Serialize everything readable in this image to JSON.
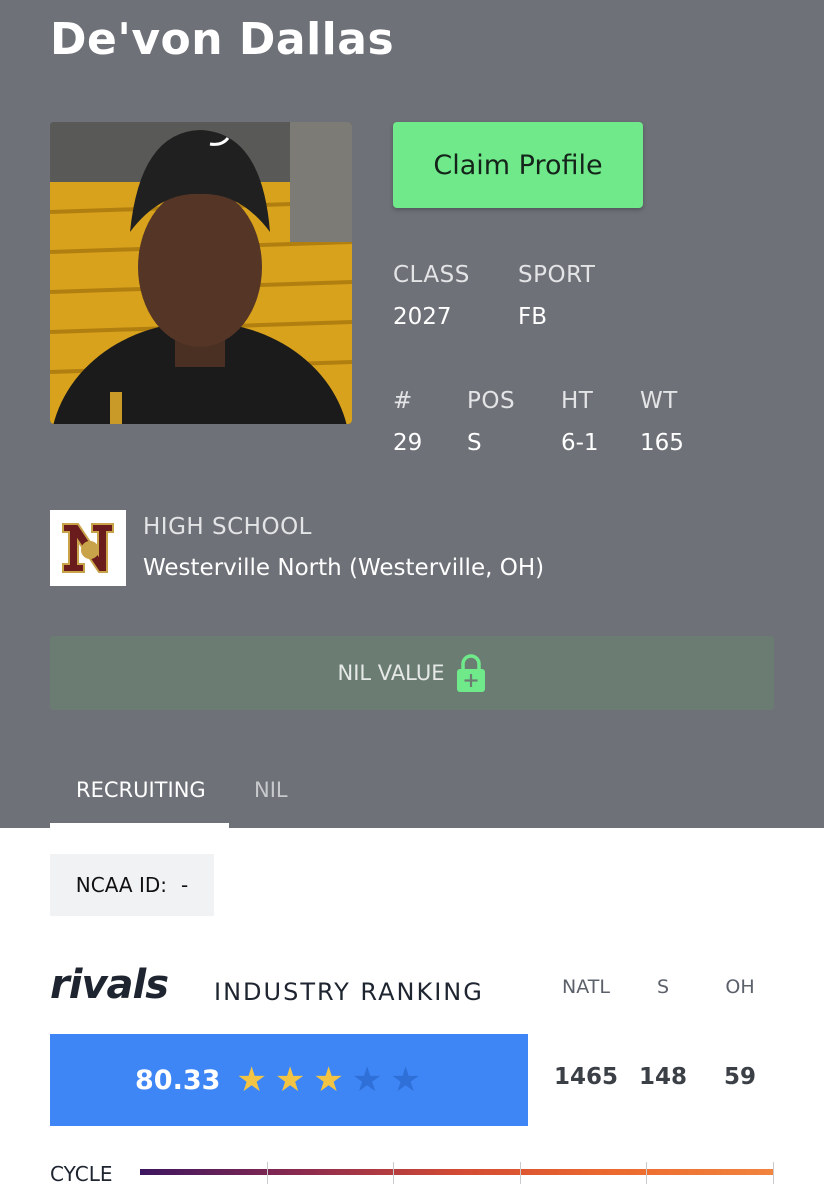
{
  "player": {
    "name": "De'von Dallas",
    "photo_icon": "player-photo"
  },
  "claim_button": {
    "label": "Claim Profile",
    "color": "#6fe98a"
  },
  "info": {
    "class_label": "CLASS",
    "class_value": "2027",
    "sport_label": "SPORT",
    "sport_value": "FB",
    "number_label": "#",
    "number_value": "29",
    "pos_label": "POS",
    "pos_value": "S",
    "ht_label": "HT",
    "ht_value": "6-1",
    "wt_label": "WT",
    "wt_value": "165"
  },
  "school": {
    "label": "HIGH SCHOOL",
    "name": "Westerville North (Westerville, OH)",
    "logo_icon": "school-logo"
  },
  "nil": {
    "label": "NIL VALUE",
    "icon": "lock-icon",
    "color": "#6b7d73"
  },
  "tabs": [
    {
      "label": "RECRUITING",
      "active": true
    },
    {
      "label": "NIL",
      "active": false
    }
  ],
  "ncaa": {
    "label": "NCAA ID:",
    "value": "-"
  },
  "ranking": {
    "brand": "rivals",
    "title": "INDUSTRY RANKING",
    "columns": [
      "NATL",
      "S",
      "OH"
    ],
    "values": [
      "1465",
      "148",
      "59"
    ],
    "score": "80.33",
    "stars_filled": 3,
    "stars_total": 5,
    "bar_color": "#3e86f5"
  },
  "cycle": {
    "label": "CYCLE"
  }
}
